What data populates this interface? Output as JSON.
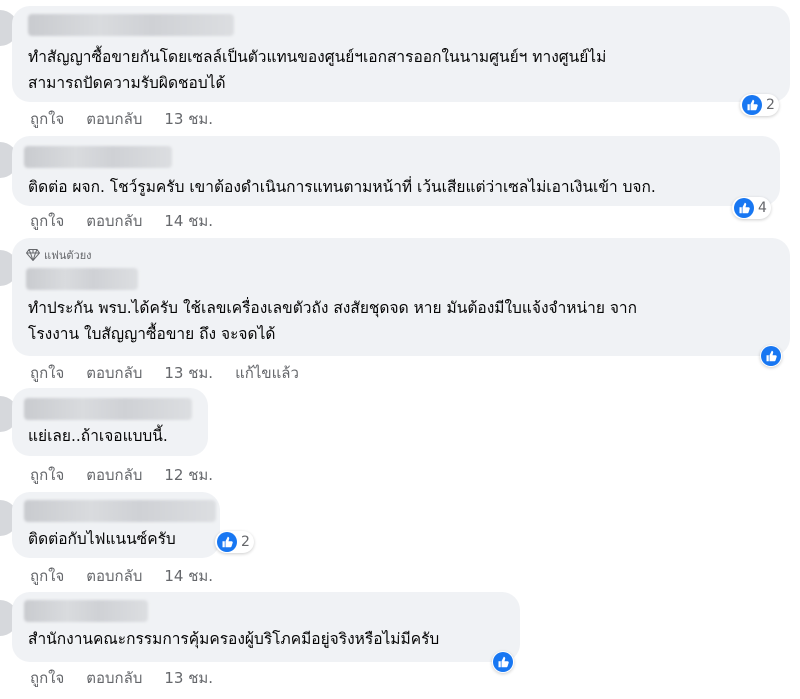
{
  "actions": {
    "like": "ถูกใจ",
    "reply": "ตอบกลับ",
    "edited": "แก้ไขแล้ว"
  },
  "badge": {
    "fan_label": "แฟนตัวยง",
    "icon": "diamond-icon"
  },
  "reaction_icon": "thumbs-up-icon",
  "colors": {
    "bubble": "#f0f2f5",
    "like_blue": "#1877f2",
    "secondary_text": "#65676b"
  },
  "comments": [
    {
      "text": "ทำสัญญาซื้อขายกันโดยเซลล์เป็นตัวแทนของศูนย์ฯเอกสารออกในนามศูนย์ฯ ทางศูนย์ไม่\nสามารถปัดความรับผิดชอบได้",
      "time": "13 ชม.",
      "reactions": "2"
    },
    {
      "text": "ติดต่อ ผจก. โชว์รูมครับ เขาต้องดำเนินการแทนตามหน้าที่ เว้นเสียแต่ว่าเซลไม่เอาเงินเข้า บจก.",
      "time": "14 ชม.",
      "reactions": "4"
    },
    {
      "text": "ทำประกัน พรบ.ได้ครับ ใช้เลขเครื่องเลขตัวถัง สงสัยชุดจด หาย มันต้องมีใบแจ้งจำหน่าย จาก\nโรงงาน ใบสัญญาซื้อขาย ถึง จะจดได้",
      "time": "13 ชม.",
      "reactions": ""
    },
    {
      "text": "แย่เลย..ถ้าเจอแบบนี้.",
      "time": "12 ชม.",
      "reactions": ""
    },
    {
      "text": "ติดต่อกับไฟแนนซ์ครับ",
      "time": "14 ชม.",
      "reactions": "2"
    },
    {
      "text": "สำนักงานคณะกรรมการคุ้มครองผู้บริโภคมีอยู่จริงหรือไม่มีครับ",
      "time": "13 ชม.",
      "reactions": ""
    }
  ]
}
